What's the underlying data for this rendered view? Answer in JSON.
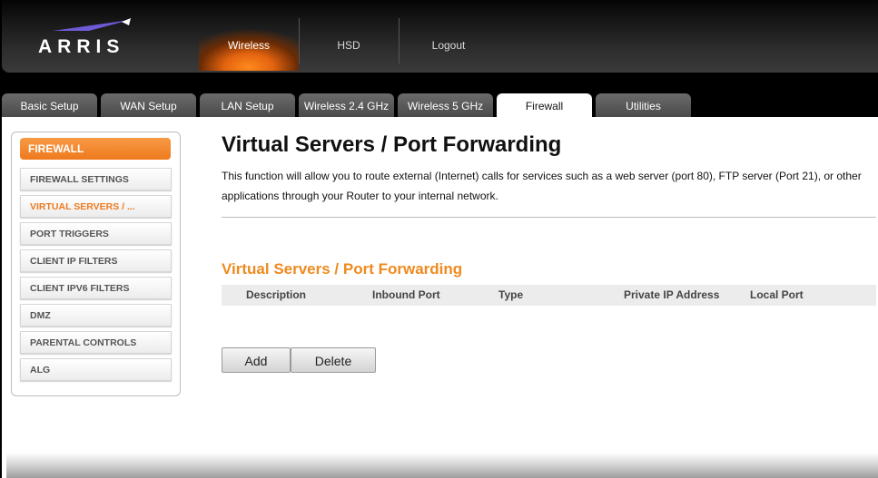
{
  "brand": {
    "logo_text": "ARRIS"
  },
  "topnav": [
    {
      "label": "Wireless",
      "active": true
    },
    {
      "label": "HSD",
      "active": false
    },
    {
      "label": "Logout",
      "active": false
    }
  ],
  "tabs": [
    {
      "label": "Basic Setup"
    },
    {
      "label": "WAN Setup"
    },
    {
      "label": "LAN Setup"
    },
    {
      "label": "Wireless 2.4 GHz"
    },
    {
      "label": "Wireless 5 GHz"
    },
    {
      "label": "Firewall",
      "active": true
    },
    {
      "label": "Utilities"
    }
  ],
  "sidebar": {
    "title": "FIREWALL",
    "items": [
      {
        "label": "FIREWALL SETTINGS"
      },
      {
        "label": "VIRTUAL SERVERS / ...",
        "active": true
      },
      {
        "label": "PORT TRIGGERS"
      },
      {
        "label": "CLIENT IP FILTERS"
      },
      {
        "label": "CLIENT IPV6 FILTERS"
      },
      {
        "label": "DMZ"
      },
      {
        "label": "PARENTAL CONTROLS"
      },
      {
        "label": "ALG"
      }
    ]
  },
  "main": {
    "title": "Virtual Servers / Port Forwarding",
    "description": "This function will allow you to route external (Internet) calls for services such as a web server (port 80), FTP server (Port 21), or other applications through your Router to your internal network.",
    "section_title": "Virtual Servers / Port Forwarding",
    "table": {
      "columns": [
        "Description",
        "Inbound Port",
        "Type",
        "Private IP Address",
        "Local Port"
      ],
      "rows": []
    },
    "buttons": {
      "add": "Add",
      "delete": "Delete"
    }
  },
  "colors": {
    "accent": "#ef7a1e",
    "tab_bg": "#5a5a5a",
    "header_bg": "#1a1a1a"
  }
}
